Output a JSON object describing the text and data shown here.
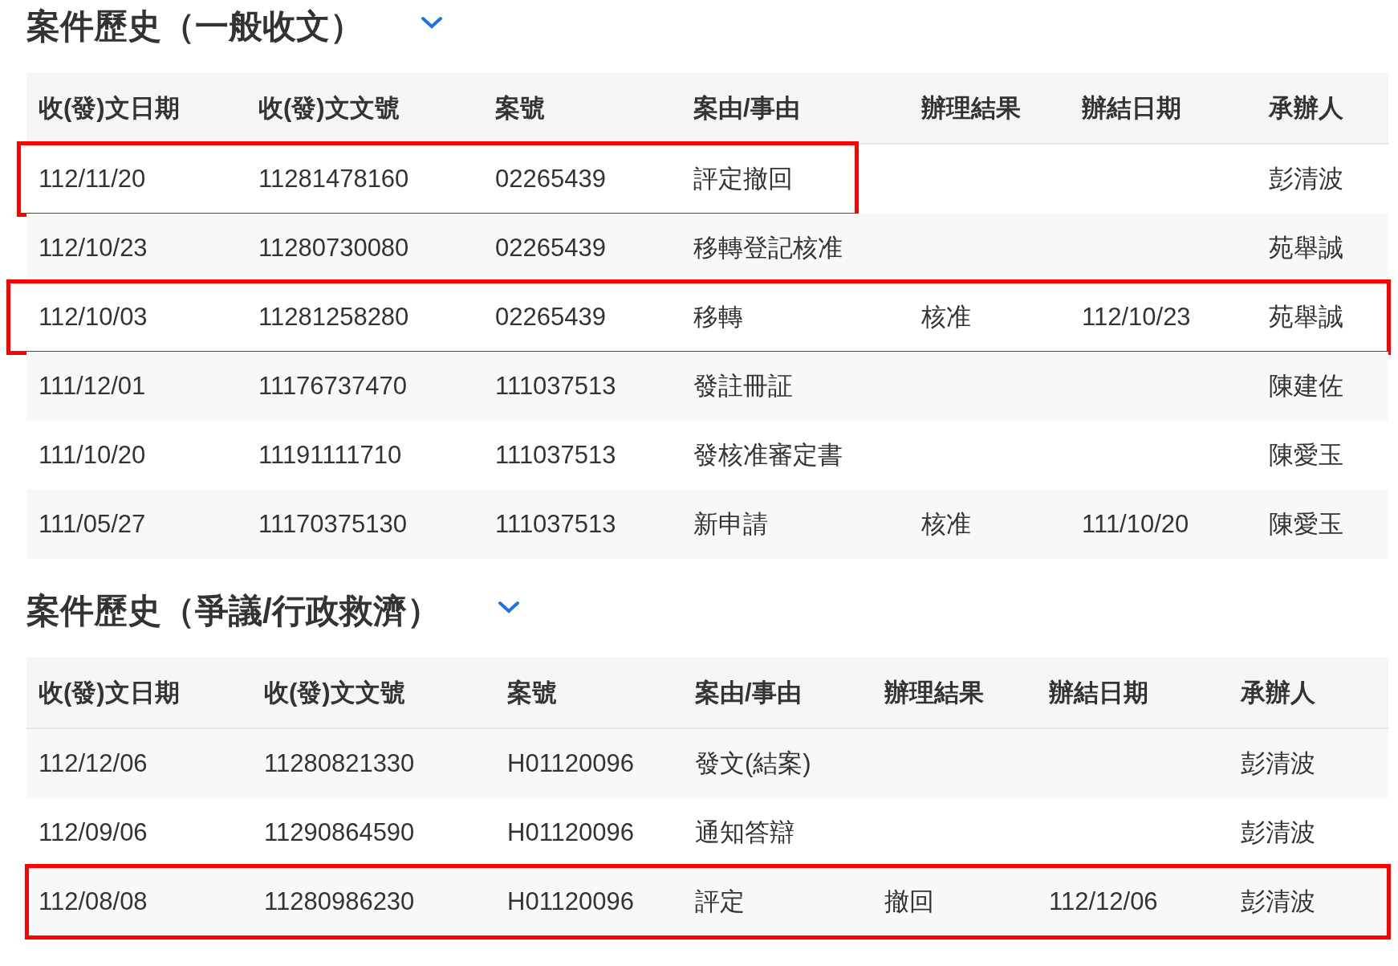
{
  "sections": [
    {
      "title": "案件歷史（一般收文）",
      "expanded": true,
      "columns": [
        "收(發)文日期",
        "收(發)文文號",
        "案號",
        "案由/事由",
        "辦理結果",
        "辦結日期",
        "承辦人"
      ],
      "rows": [
        {
          "highlighted": true,
          "highlight_whole_row": false,
          "cells": [
            "112/11/20",
            "11281478160",
            "02265439",
            "評定撤回",
            "",
            "",
            "彭清波"
          ]
        },
        {
          "highlighted": false,
          "cells": [
            "112/10/23",
            "11280730080",
            "02265439",
            "移轉登記核准",
            "",
            "",
            "苑舉誠"
          ]
        },
        {
          "highlighted": true,
          "highlight_whole_row": true,
          "cells": [
            "112/10/03",
            "11281258280",
            "02265439",
            "移轉",
            "核准",
            "112/10/23",
            "苑舉誠"
          ]
        },
        {
          "highlighted": false,
          "cells": [
            "111/12/01",
            "11176737470",
            "111037513",
            "發註冊証",
            "",
            "",
            "陳建佐"
          ]
        },
        {
          "highlighted": false,
          "cells": [
            "111/10/20",
            "11191111710",
            "111037513",
            "發核准審定書",
            "",
            "",
            "陳愛玉"
          ]
        },
        {
          "highlighted": false,
          "cells": [
            "111/05/27",
            "11170375130",
            "111037513",
            "新申請",
            "核准",
            "111/10/20",
            "陳愛玉"
          ]
        }
      ]
    },
    {
      "title": "案件歷史（爭議/行政救濟）",
      "expanded": true,
      "columns": [
        "收(發)文日期",
        "收(發)文文號",
        "案號",
        "案由/事由",
        "辦理結果",
        "辦結日期",
        "承辦人"
      ],
      "rows": [
        {
          "highlighted": false,
          "cells": [
            "112/12/06",
            "11280821330",
            "H01120096",
            "發文(結案)",
            "",
            "",
            "彭清波"
          ]
        },
        {
          "highlighted": false,
          "cells": [
            "112/09/06",
            "11290864590",
            "H01120096",
            "通知答辯",
            "",
            "",
            "彭清波"
          ]
        },
        {
          "highlighted": true,
          "highlight_whole_row": true,
          "cells": [
            "112/08/08",
            "11280986230",
            "H01120096",
            "評定",
            "撤回",
            "112/12/06",
            "彭清波"
          ]
        }
      ]
    }
  ]
}
